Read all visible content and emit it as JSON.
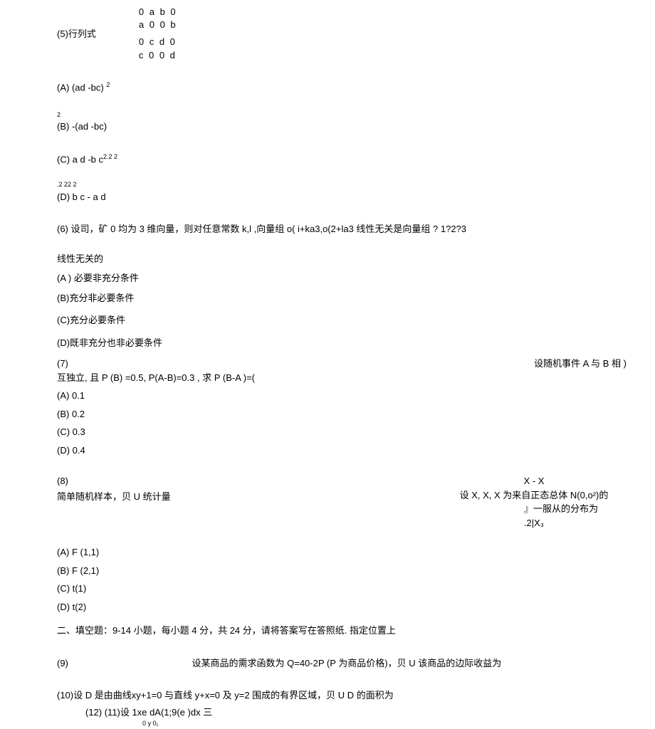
{
  "q5": {
    "label": "(5)行列式",
    "matrix": {
      "r1": "0 a b 0",
      "r2": "a 0 0 b",
      "r3": "0 c d 0",
      "r4": "c 0 0 d"
    },
    "optA": "(A) (ad -bc) ",
    "optA_sup": "2",
    "optB_sup": "2",
    "optB": "(B) -(ad -bc)",
    "optC": "(C) a d -b c",
    "optC_sup": "2.2 2",
    "optD_sup": ".2 22 2",
    "optD": "(D) b c - a d"
  },
  "q6": {
    "text": "(6) 设司，矿 0 均为 3 维向量，则对任意常数 k,l ,向量组 o( i+ka3,o(2+la3 线性无关是向量组  ? 1?2?3",
    "sub1": "线性无关的",
    "optA": "(A ) 必要非充分条件",
    "optB": "(B)充分非必要条件",
    "optC": "(C)充分必要条件",
    "optD": "(D)既非充分也非必要条件"
  },
  "q7": {
    "num": "(7)",
    "right": "设随机事件 A 与 B 相  )",
    "line2": "互独立, 且 P (B) =0.5, P(A-B)=0.3 , 求 P (B-A )=(",
    "optA": "(A)    0.1",
    "optB": "(B)    0.2",
    "optC": "(C)    0.3",
    "optD": "(D)    0.4"
  },
  "q8": {
    "num": "(8)",
    "left2": "简单随机样本，贝 U 统计量",
    "right1": "X - X",
    "right2": "设 X, X, X 为来自正态总体  N(0,o²)的",
    "right3": "』一服从的分布为",
    "right4": ".2|X₃",
    "optA": "(A)    F (1,1)",
    "optB": "(B)    F (2,1)",
    "optC": "(C)    t(1)",
    "optD": "(D)    t(2)"
  },
  "section2": "二、填空题：9-14 小题，每小题 4 分，共 24 分，请将答案写在答照纸. 指定位置上",
  "q9": {
    "num": "(9)",
    "text": "设某商品的需求函数为 Q=40-2P (P 为商品价格)，贝 U 该商品的边际收益为"
  },
  "q10": {
    "text": "(10)设 D 是由曲线xy+1=0 与直线 y+x=0 及 y=2 围成的有界区域，贝 U D 的面积为"
  },
  "q11": {
    "text": "(12)   (11)设  1xe  dA(1;9(e )dx 三",
    "sub": "0 y  0₁"
  }
}
